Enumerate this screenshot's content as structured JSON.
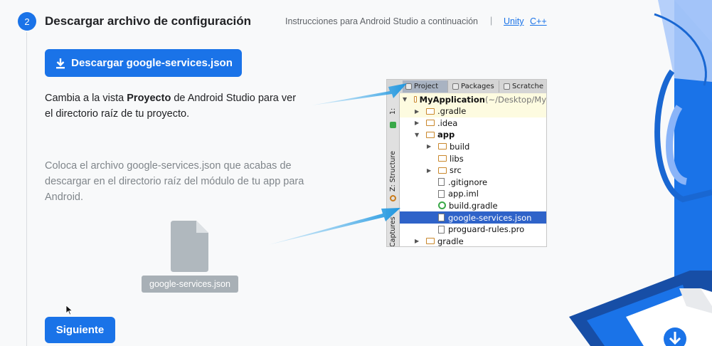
{
  "step": {
    "number": "2",
    "title": "Descargar archivo de configuración",
    "instructions": "Instrucciones para Android Studio a continuación",
    "separator": "|",
    "links": [
      "Unity",
      "C++"
    ]
  },
  "download_button": {
    "label": "Descargar google-services.json",
    "icon": "download-icon"
  },
  "paragraph1": {
    "part1": "Cambia a la vista ",
    "bold": "Proyecto",
    "part2": " de Android Studio para ver el directorio raíz de tu proyecto."
  },
  "paragraph2": "Coloca el archivo google-services.json que acabas de descargar en el directorio raíz del módulo de tu app para Android.",
  "file": {
    "label": "google-services.json",
    "icon": "file-icon"
  },
  "next_button": {
    "label": "Siguiente"
  },
  "ide": {
    "tabs": [
      "Project",
      "Packages",
      "Scratche"
    ],
    "side_labels": [
      "1:",
      "Z: Structure",
      "Captures"
    ],
    "tree": [
      {
        "indent": 0,
        "arrow": "▼",
        "icon": "module",
        "label": "MyApplication",
        "extra": " (~/Desktop/My",
        "bold": true,
        "highlight": "yellow"
      },
      {
        "indent": 1,
        "arrow": "▶",
        "icon": "folder",
        "label": ".gradle",
        "highlight": "yellow"
      },
      {
        "indent": 1,
        "arrow": "▶",
        "icon": "folder",
        "label": ".idea"
      },
      {
        "indent": 1,
        "arrow": "▼",
        "icon": "folder",
        "label": "app",
        "bold": true
      },
      {
        "indent": 2,
        "arrow": "▶",
        "icon": "folder",
        "label": "build"
      },
      {
        "indent": 2,
        "arrow": "",
        "icon": "folder",
        "label": "libs"
      },
      {
        "indent": 2,
        "arrow": "▶",
        "icon": "folder",
        "label": "src"
      },
      {
        "indent": 2,
        "arrow": "",
        "icon": "file",
        "label": ".gitignore"
      },
      {
        "indent": 2,
        "arrow": "",
        "icon": "file",
        "label": "app.iml"
      },
      {
        "indent": 2,
        "arrow": "",
        "icon": "gradle",
        "label": "build.gradle"
      },
      {
        "indent": 2,
        "arrow": "",
        "icon": "file",
        "label": "google-services.json",
        "highlight": "selected"
      },
      {
        "indent": 2,
        "arrow": "",
        "icon": "file",
        "label": "proguard-rules.pro"
      },
      {
        "indent": 1,
        "arrow": "▶",
        "icon": "folder",
        "label": "gradle"
      }
    ]
  },
  "colors": {
    "accent": "#1a73e8",
    "selection": "#2f63c9",
    "callout": "#2a9fe0"
  }
}
